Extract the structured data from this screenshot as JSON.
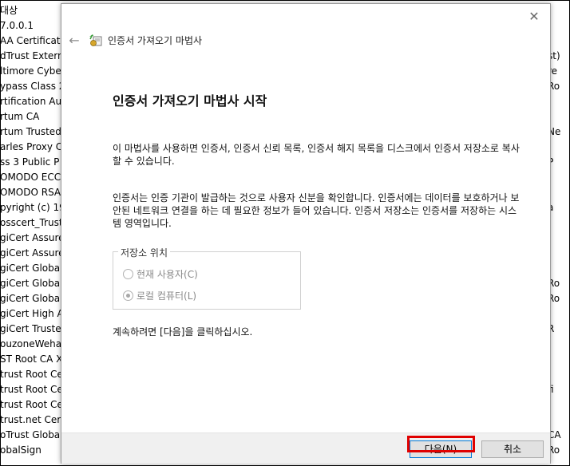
{
  "background_list": {
    "items": [
      "대상",
      "7.0.0.1",
      "AA Certificate",
      "dTrust Externa",
      "ltimore Cyber",
      "ypass Class 2",
      "rtification Aut",
      "rtum CA",
      "rtum Trusted",
      "arles Proxy C",
      "ss 3 Public P",
      "OMODO ECC C",
      "OMODO RSA C",
      "pyright (c) 19",
      "osscert_Trust_",
      "giCert Assured",
      "giCert Assured",
      "giCert Global",
      "giCert Global",
      "giCert Global",
      "giCert High A",
      "giCert Trusted",
      "ouzoneWehag",
      "ST Root CA X3",
      "trust Root Cer",
      "trust Root Cer",
      "trust Root Cer",
      "trust.net Certi",
      "oTrust Global",
      "obalSign"
    ]
  },
  "background_right": {
    "items": [
      {
        "row": 3,
        "text": "st)"
      },
      {
        "row": 4,
        "text": "re"
      },
      {
        "row": 5,
        "text": "Ro"
      },
      {
        "row": 8,
        "text": "Ne"
      },
      {
        "row": 10,
        "text": "P"
      },
      {
        "row": 11,
        "text": ""
      },
      {
        "row": 12,
        "text": ""
      },
      {
        "row": 13,
        "text": "a"
      },
      {
        "row": 18,
        "text": "Ro"
      },
      {
        "row": 19,
        "text": "Ro"
      },
      {
        "row": 21,
        "text": "R"
      },
      {
        "row": 25,
        "text": "fi"
      },
      {
        "row": 28,
        "text": "CA"
      },
      {
        "row": 29,
        "text": "Ro"
      }
    ]
  },
  "dialog": {
    "title": "인증서 가져오기 마법사",
    "heading": "인증서 가져오기 마법사 시작",
    "para1": "이 마법사를 사용하면 인증서, 인증서 신뢰 목록, 인증서 해지 목록을 디스크에서 인증서 저장소로 복사할 수 있습니다.",
    "para2": "인증서는 인증 기관이 발급하는 것으로 사용자 신분을 확인합니다. 인증서에는 데이터를 보호하거나 보안된 네트워크 연결을 하는 데 필요한 정보가 들어 있습니다. 인증서 저장소는 인증서를 저장하는 시스템 영역입니다.",
    "store_location": {
      "legend": "저장소 위치",
      "options": [
        {
          "label": "현재 사용자(C)",
          "checked": false
        },
        {
          "label": "로컬 컴퓨터(L)",
          "checked": true
        }
      ]
    },
    "continue_text": "계속하려면 [다음]을 클릭하십시오.",
    "buttons": {
      "next": "다음(N)",
      "cancel": "취소"
    },
    "close_icon": "close-icon",
    "back_icon": "back-arrow-icon",
    "wizard_icon": "certificate-wizard-icon"
  },
  "colors": {
    "highlight": "#e00000",
    "accent": "#0078d7"
  }
}
